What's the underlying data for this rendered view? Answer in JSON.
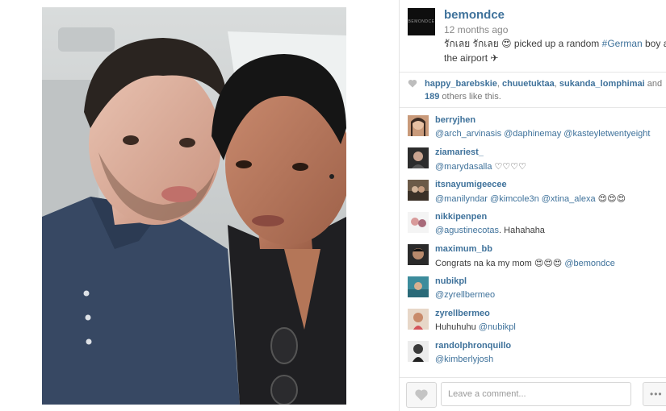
{
  "post": {
    "username": "bemondce",
    "avatar_text": "BEMONDCE",
    "time": "12 months ago",
    "caption_before": "รักเลย รักเลย 😍 picked up a random ",
    "caption_tag": "#German",
    "caption_after": " boy at the airport ✈"
  },
  "likes": {
    "user1": "happy_barebskie",
    "sep1": ", ",
    "user2": "chuuetuktaa",
    "sep2": ", ",
    "user3": "sukanda_lomphimai",
    "and_word": " and",
    "count": "189",
    "others_text": " others like this."
  },
  "comments": [
    {
      "user": "berryjhen",
      "mention": "@arch_arvinasis @daphinemay @kasteyletwentyeight",
      "text": ""
    },
    {
      "user": "ziamariest_",
      "mention": "@marydasalla",
      "text": " ♡♡♡♡"
    },
    {
      "user": "itsnayumigeecee",
      "mention": "@manilyndar @kimcole3n @xtina_alexa",
      "text": " 😍😍😍"
    },
    {
      "user": "nikkipenpen",
      "mention": "@agustinecotas",
      "text": ". Hahahaha"
    },
    {
      "user": "maximum_bb",
      "mention_before": "Congrats na ka my mom 😍😍😍 ",
      "mention": "@bemondce",
      "text": ""
    },
    {
      "user": "nubikpl",
      "mention": "@zyrellbermeo",
      "text": ""
    },
    {
      "user": "zyrellbermeo",
      "mention_before": "Huhuhuhu ",
      "mention": "@nubikpl",
      "text": ""
    },
    {
      "user": "randolphronquillo",
      "mention": "@kimberlyjosh",
      "text": ""
    }
  ],
  "footer": {
    "comment_placeholder": "Leave a comment...",
    "more_label": "•••"
  },
  "icons": {
    "heart": "heart-icon",
    "more": "more-options-icon"
  },
  "colors": {
    "link": "#3f729b",
    "text": "#3d3d3d",
    "muted": "#888888"
  }
}
